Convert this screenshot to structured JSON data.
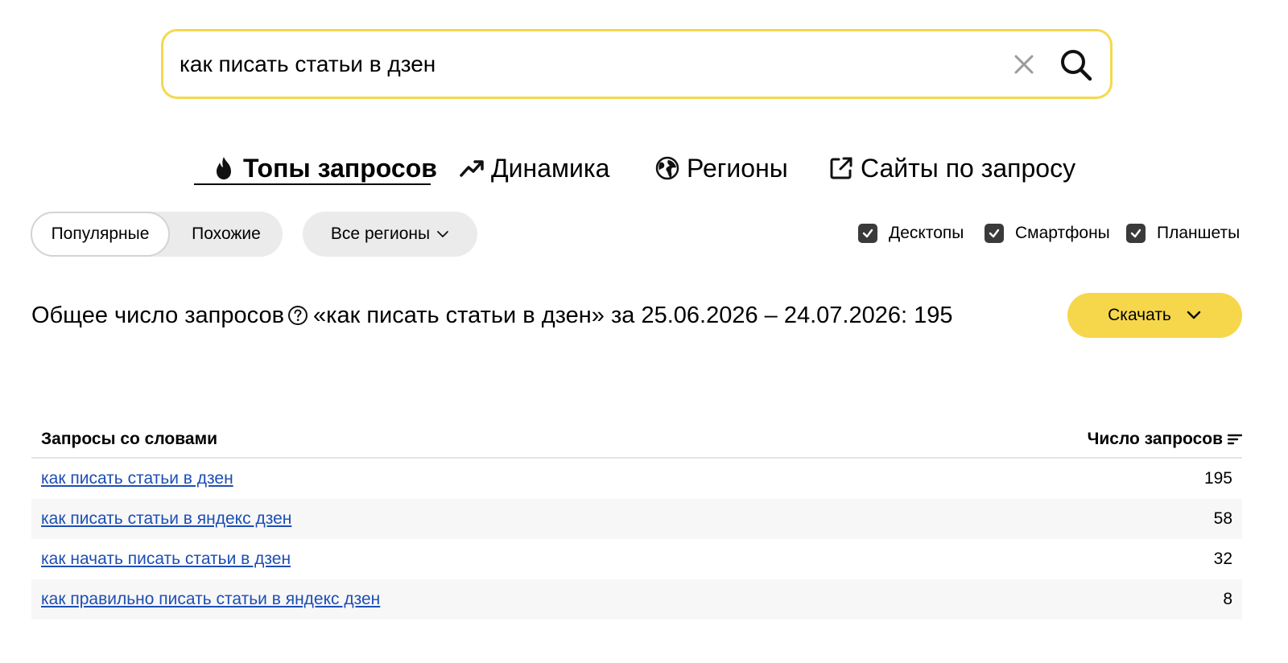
{
  "search": {
    "value": "как писать статьи в дзен"
  },
  "tabs": [
    {
      "label": "Топы запросов",
      "icon": "fire-icon",
      "active": true
    },
    {
      "label": "Динамика",
      "icon": "trend-up-icon",
      "active": false
    },
    {
      "label": "Регионы",
      "icon": "globe-icon",
      "active": false
    },
    {
      "label": "Сайты по запросу",
      "icon": "external-link-icon",
      "active": false
    }
  ],
  "filters": {
    "mode": {
      "popular": "Популярные",
      "similar": "Похожие",
      "selected": "Популярные"
    },
    "region": "Все регионы",
    "devices": [
      {
        "label": "Десктопы",
        "checked": true
      },
      {
        "label": "Смартфоны",
        "checked": true
      },
      {
        "label": "Планшеты",
        "checked": true
      }
    ]
  },
  "summary": {
    "prefix": "Общее число запросов",
    "text": "«как писать статьи в дзен» за 25.06.2026 – 24.07.2026: 195",
    "download_label": "Скачать"
  },
  "table": {
    "col_query": "Запросы со словами",
    "col_count": "Число запросов",
    "rows": [
      {
        "query": "как писать статьи в дзен",
        "count": "195"
      },
      {
        "query": "как писать статьи в яндекс дзен",
        "count": "58"
      },
      {
        "query": "как начать писать статьи в дзен",
        "count": "32"
      },
      {
        "query": "как правильно писать статьи в яндекс дзен",
        "count": "8"
      }
    ]
  },
  "colors": {
    "accent_yellow": "#f6d74b",
    "search_border": "#f5d84f",
    "link": "#1d4eb5"
  }
}
